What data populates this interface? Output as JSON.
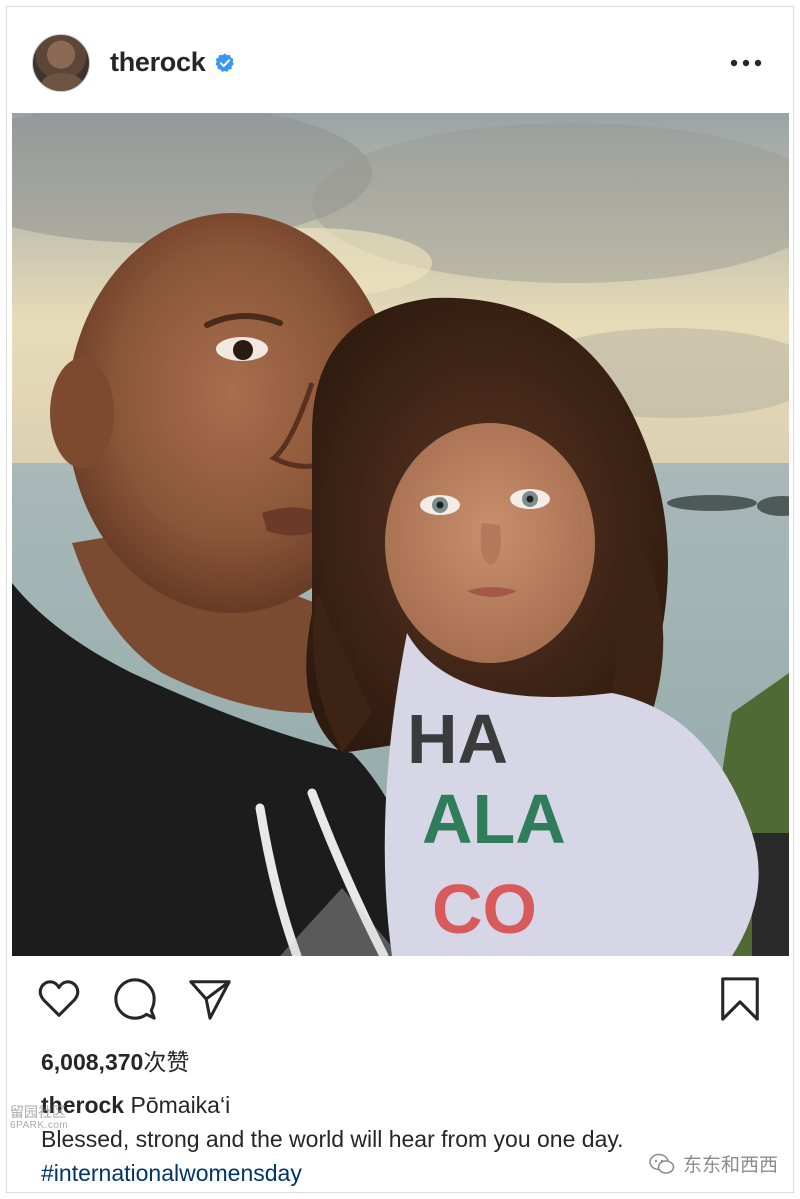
{
  "post": {
    "username": "therock",
    "verified": true,
    "more_icon": "more-horizontal-icon"
  },
  "photo": {
    "icon": "photo"
  },
  "actions": {
    "like_icon": "heart-icon",
    "comment_icon": "comment-icon",
    "share_icon": "send-icon",
    "save_icon": "bookmark-icon"
  },
  "likes": {
    "count": "6,008,370",
    "suffix": "次赞"
  },
  "caption": {
    "username": "therock",
    "first_line": "Pōmaika‘i",
    "second_line": "Blessed, strong and the world will hear from you one day.",
    "hashtag": "#internationalwomensday"
  },
  "watermarks": {
    "left_top": "留园社区",
    "left_bottom": "6PARK.com",
    "right": "东东和西西"
  },
  "colors": {
    "text": "#262626",
    "hashtag": "#003569",
    "verified": "#3897f0",
    "border": "#dbdbdb"
  }
}
